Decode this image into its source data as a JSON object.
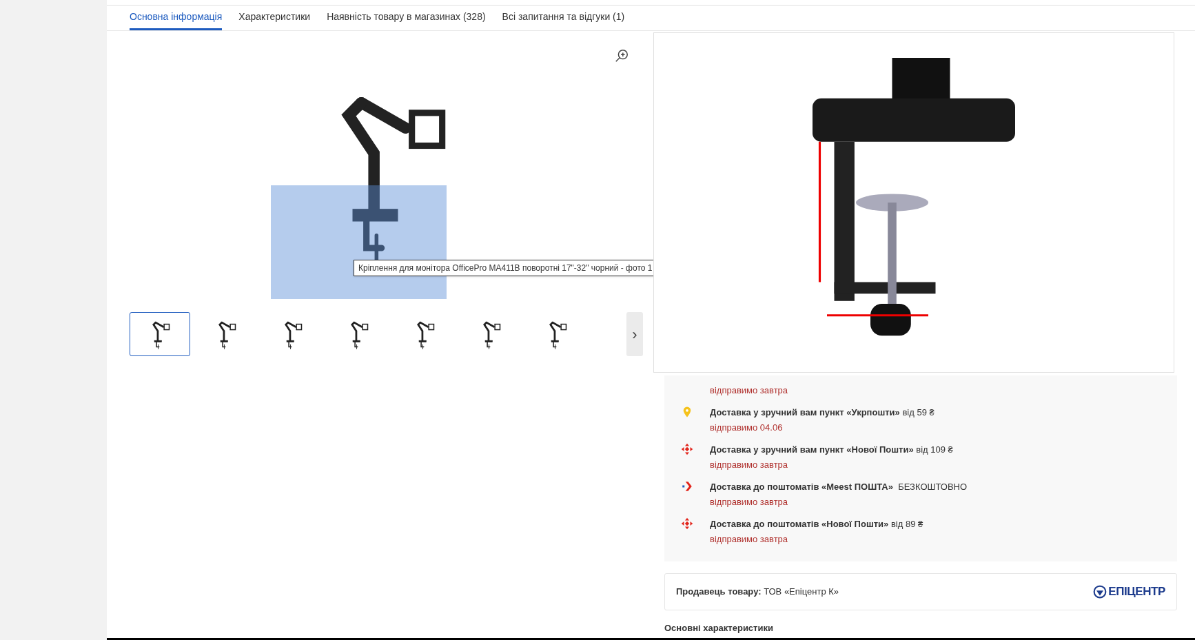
{
  "tabs": [
    {
      "label": "Основна інформація",
      "selected": true
    },
    {
      "label": "Характеристики",
      "selected": false
    },
    {
      "label": "Наявність товару в магазинах (328)",
      "selected": false
    },
    {
      "label": "Всі запитання та відгуки (1)",
      "selected": false
    }
  ],
  "gallery": {
    "tooltip": "Кріплення для монітора OfficePro MA411B поворотні 17\"-32\" чорний - фото 1",
    "thumbnails": [
      {
        "selected": true
      },
      {
        "selected": false
      },
      {
        "selected": false
      },
      {
        "selected": false
      },
      {
        "selected": false
      },
      {
        "selected": false
      },
      {
        "selected": false
      }
    ],
    "next": "›"
  },
  "delivery": {
    "first_note": "відправимо завтра",
    "items": [
      {
        "kind": "pin",
        "title": "**Доставка у зручний вам пункт «Укрпошти»** від 59 ₴",
        "note": "відправимо 04.06"
      },
      {
        "kind": "arrows",
        "title": "**Доставка у зручний вам пункт «Нової Пошти»** від 109 ₴",
        "note": "відправимо завтра"
      },
      {
        "kind": "chevron",
        "title": "**Доставка до поштоматів «Meest ПОШТА»**  БЕЗКОШТОВНО",
        "note": "відправимо завтра"
      },
      {
        "kind": "arrows",
        "title": "**Доставка до поштоматів «Нової Пошти»** від 89 ₴",
        "note": "відправимо завтра"
      }
    ]
  },
  "seller": {
    "text": "**Продавець товару:** ТОВ «Епіцентр К»",
    "logo": "ЕПІЦЕНТР"
  },
  "section_title": "Основні характеристики"
}
